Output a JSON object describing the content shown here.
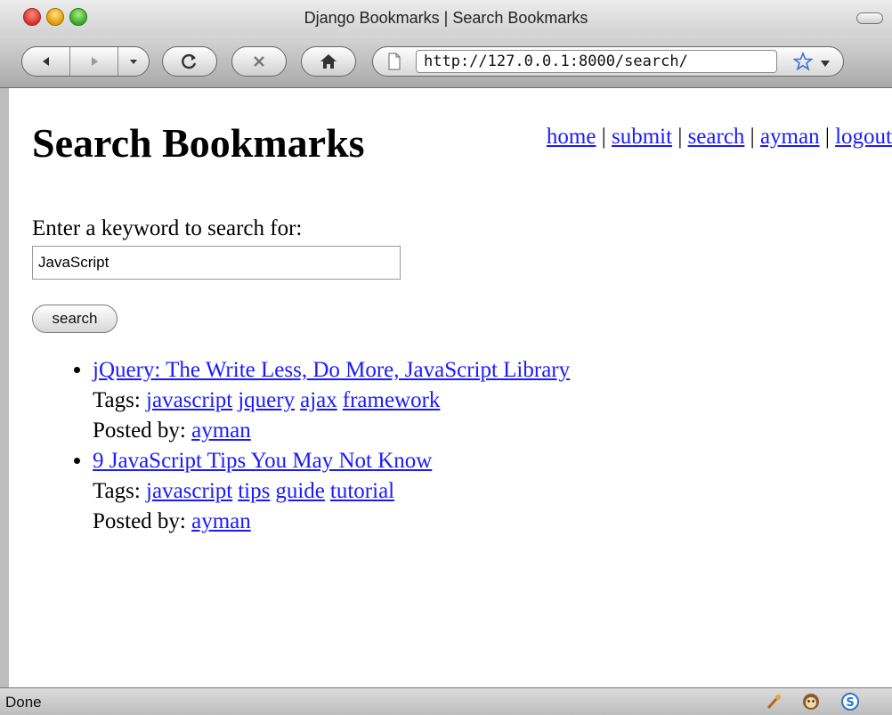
{
  "window": {
    "title": "Django Bookmarks | Search Bookmarks"
  },
  "toolbar": {
    "back_icon": "back-arrow-icon",
    "forward_icon": "forward-arrow-icon",
    "history_icon": "chevron-down-icon",
    "reload_icon": "reload-icon",
    "stop_icon": "stop-icon",
    "home_icon": "home-icon",
    "url": "http://127.0.0.1:8000/search/",
    "bookmark_icon": "star-icon"
  },
  "page": {
    "title": "Search Bookmarks",
    "nav": [
      {
        "label": "home"
      },
      {
        "label": "submit"
      },
      {
        "label": "search"
      },
      {
        "label": "ayman"
      },
      {
        "label": "logout"
      }
    ],
    "nav_sep": "|",
    "form": {
      "label": "Enter a keyword to search for:",
      "value": "JavaScript",
      "button": "search"
    },
    "tags_label": "Tags:",
    "posted_label": "Posted by:",
    "results": [
      {
        "title": "jQuery: The Write Less, Do More, JavaScript Library",
        "tags": [
          "javascript",
          "jquery",
          "ajax",
          "framework"
        ],
        "user": "ayman"
      },
      {
        "title": "9 JavaScript Tips You May Not Know",
        "tags": [
          "javascript",
          "tips",
          "guide",
          "tutorial"
        ],
        "user": "ayman"
      }
    ]
  },
  "status": {
    "text": "Done"
  },
  "colors": {
    "link": "#1a1aff"
  }
}
